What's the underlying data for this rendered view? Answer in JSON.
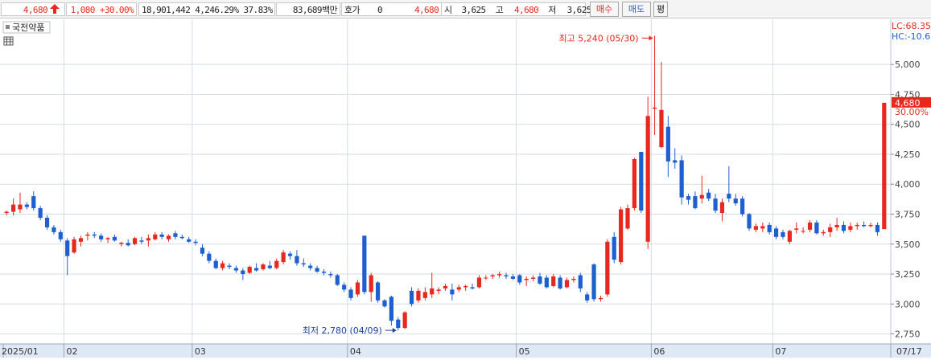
{
  "header": {
    "price": "4,680",
    "change": "1,080",
    "change_rate": "+30.00%",
    "volume": "18,901,442",
    "volume_rate": "4,246.29%",
    "turnover": "37.83%",
    "amount": "83,689백만",
    "hoga_label": "호가",
    "hoga_value": "0",
    "hoga_price": "4,680",
    "open_label": "시",
    "open": "3,625",
    "high_label": "고",
    "high": "4,680",
    "low_label": "저",
    "low": "3,625",
    "buy_label": "매수",
    "sell_label": "매도",
    "eval_label": "평"
  },
  "chart": {
    "stock_name": "국전약품",
    "lc_label": "LC:68.35",
    "hc_label": "HC:-10.6",
    "current_price_tag": "4,680",
    "current_rate_tag": "30.00%",
    "high_note": "최고 5,240 (05/30)",
    "low_note": "최저 2,780 (04/09)",
    "y_ticks": [
      "5,000",
      "4,750",
      "4,500",
      "4,250",
      "4,000",
      "3,750",
      "3,500",
      "3,250",
      "3,000",
      "2,750"
    ],
    "x_labels": [
      "2025/01",
      "02",
      "03",
      "04",
      "05",
      "06",
      "07",
      "07/17"
    ],
    "colors": {
      "up": "#e8281e",
      "down": "#1e5fd0",
      "grid": "#d5dce6",
      "axis_bg": "#dfe8f5"
    }
  },
  "chart_data": {
    "type": "candlestick",
    "ylim": [
      2680,
      5350
    ],
    "series": [
      {
        "date": "2025/01",
        "o": 3760,
        "h": 3780,
        "l": 3740,
        "c": 3770
      },
      {
        "o": 3770,
        "h": 3880,
        "l": 3740,
        "c": 3830
      },
      {
        "o": 3790,
        "h": 3930,
        "l": 3760,
        "c": 3830
      },
      {
        "o": 3830,
        "h": 3850,
        "l": 3790,
        "c": 3810
      },
      {
        "o": 3900,
        "h": 3940,
        "l": 3780,
        "c": 3800
      },
      {
        "o": 3800,
        "h": 3820,
        "l": 3700,
        "c": 3720
      },
      {
        "o": 3720,
        "h": 3740,
        "l": 3620,
        "c": 3640
      },
      {
        "o": 3640,
        "h": 3660,
        "l": 3580,
        "c": 3600
      },
      {
        "o": 3600,
        "h": 3620,
        "l": 3520,
        "c": 3540
      },
      {
        "date": "02",
        "o": 3530,
        "h": 3550,
        "l": 3240,
        "c": 3400
      },
      {
        "o": 3430,
        "h": 3560,
        "l": 3420,
        "c": 3540
      },
      {
        "o": 3520,
        "h": 3570,
        "l": 3480,
        "c": 3550
      },
      {
        "o": 3570,
        "h": 3600,
        "l": 3530,
        "c": 3580
      },
      {
        "o": 3580,
        "h": 3600,
        "l": 3550,
        "c": 3570
      },
      {
        "o": 3570,
        "h": 3590,
        "l": 3520,
        "c": 3540
      },
      {
        "o": 3540,
        "h": 3560,
        "l": 3510,
        "c": 3550
      },
      {
        "o": 3560,
        "h": 3580,
        "l": 3520,
        "c": 3530
      },
      {
        "o": 3500,
        "h": 3520,
        "l": 3480,
        "c": 3510
      },
      {
        "o": 3510,
        "h": 3540,
        "l": 3480,
        "c": 3490
      },
      {
        "o": 3500,
        "h": 3560,
        "l": 3490,
        "c": 3550
      },
      {
        "o": 3530,
        "h": 3560,
        "l": 3500,
        "c": 3520
      },
      {
        "o": 3530,
        "h": 3580,
        "l": 3480,
        "c": 3550
      },
      {
        "o": 3540,
        "h": 3600,
        "l": 3530,
        "c": 3580
      },
      {
        "o": 3580,
        "h": 3600,
        "l": 3540,
        "c": 3560
      },
      {
        "o": 3540,
        "h": 3580,
        "l": 3520,
        "c": 3570
      },
      {
        "o": 3590,
        "h": 3610,
        "l": 3540,
        "c": 3560
      },
      {
        "o": 3560,
        "h": 3580,
        "l": 3540,
        "c": 3550
      },
      {
        "o": 3540,
        "h": 3560,
        "l": 3510,
        "c": 3520
      },
      {
        "date": "03",
        "o": 3520,
        "h": 3540,
        "l": 3490,
        "c": 3510
      },
      {
        "o": 3470,
        "h": 3500,
        "l": 3400,
        "c": 3420
      },
      {
        "o": 3420,
        "h": 3440,
        "l": 3340,
        "c": 3360
      },
      {
        "o": 3360,
        "h": 3380,
        "l": 3290,
        "c": 3300
      },
      {
        "o": 3300,
        "h": 3360,
        "l": 3280,
        "c": 3340
      },
      {
        "o": 3320,
        "h": 3340,
        "l": 3290,
        "c": 3310
      },
      {
        "o": 3300,
        "h": 3320,
        "l": 3260,
        "c": 3280
      },
      {
        "o": 3280,
        "h": 3300,
        "l": 3200,
        "c": 3250
      },
      {
        "o": 3260,
        "h": 3320,
        "l": 3250,
        "c": 3310
      },
      {
        "o": 3300,
        "h": 3340,
        "l": 3270,
        "c": 3280
      },
      {
        "o": 3290,
        "h": 3340,
        "l": 3280,
        "c": 3330
      },
      {
        "o": 3320,
        "h": 3360,
        "l": 3290,
        "c": 3300
      },
      {
        "o": 3300,
        "h": 3380,
        "l": 3290,
        "c": 3360
      },
      {
        "o": 3350,
        "h": 3450,
        "l": 3330,
        "c": 3430
      },
      {
        "o": 3420,
        "h": 3440,
        "l": 3370,
        "c": 3400
      },
      {
        "o": 3400,
        "h": 3450,
        "l": 3320,
        "c": 3340
      },
      {
        "o": 3340,
        "h": 3380,
        "l": 3310,
        "c": 3330
      },
      {
        "o": 3320,
        "h": 3340,
        "l": 3280,
        "c": 3300
      },
      {
        "o": 3300,
        "h": 3320,
        "l": 3260,
        "c": 3270
      },
      {
        "o": 3270,
        "h": 3290,
        "l": 3240,
        "c": 3260
      },
      {
        "o": 3250,
        "h": 3270,
        "l": 3220,
        "c": 3240
      },
      {
        "o": 3240,
        "h": 3250,
        "l": 3150,
        "c": 3160
      },
      {
        "o": 3160,
        "h": 3180,
        "l": 3100,
        "c": 3120
      },
      {
        "date": "04",
        "o": 3120,
        "h": 3140,
        "l": 3030,
        "c": 3050
      },
      {
        "o": 3080,
        "h": 3200,
        "l": 3060,
        "c": 3180
      },
      {
        "o": 3570,
        "h": 3570,
        "l": 3080,
        "c": 3100
      },
      {
        "o": 3100,
        "h": 3260,
        "l": 3020,
        "c": 3240
      },
      {
        "o": 3180,
        "h": 3190,
        "l": 3010,
        "c": 3030
      },
      {
        "o": 3030,
        "h": 3040,
        "l": 2970,
        "c": 2980
      },
      {
        "o": 3060,
        "h": 3070,
        "l": 2820,
        "c": 2860
      },
      {
        "o": 2870,
        "h": 2890,
        "l": 2780,
        "c": 2800
      },
      {
        "o": 2800,
        "h": 2940,
        "l": 2790,
        "c": 2930
      },
      {
        "o": 3110,
        "h": 3140,
        "l": 2980,
        "c": 3000
      },
      {
        "o": 3030,
        "h": 3130,
        "l": 3010,
        "c": 3110
      },
      {
        "o": 3050,
        "h": 3140,
        "l": 3030,
        "c": 3100
      },
      {
        "o": 3080,
        "h": 3260,
        "l": 3050,
        "c": 3130
      },
      {
        "o": 3110,
        "h": 3140,
        "l": 3080,
        "c": 3120
      },
      {
        "o": 3130,
        "h": 3170,
        "l": 3110,
        "c": 3150
      },
      {
        "o": 3120,
        "h": 3170,
        "l": 3030,
        "c": 3080
      },
      {
        "o": 3120,
        "h": 3160,
        "l": 3100,
        "c": 3140
      },
      {
        "o": 3140,
        "h": 3160,
        "l": 3110,
        "c": 3150
      },
      {
        "o": 3140,
        "h": 3170,
        "l": 3120,
        "c": 3130
      },
      {
        "o": 3140,
        "h": 3240,
        "l": 3130,
        "c": 3220
      },
      {
        "o": 3220,
        "h": 3240,
        "l": 3200,
        "c": 3220
      },
      {
        "o": 3230,
        "h": 3250,
        "l": 3210,
        "c": 3240
      },
      {
        "o": 3240,
        "h": 3270,
        "l": 3220,
        "c": 3250
      },
      {
        "o": 3240,
        "h": 3260,
        "l": 3210,
        "c": 3230
      },
      {
        "o": 3230,
        "h": 3250,
        "l": 3200,
        "c": 3210
      },
      {
        "date": "05",
        "o": 3240,
        "h": 3250,
        "l": 3160,
        "c": 3180
      },
      {
        "o": 3200,
        "h": 3230,
        "l": 3150,
        "c": 3210
      },
      {
        "o": 3210,
        "h": 3240,
        "l": 3190,
        "c": 3220
      },
      {
        "o": 3230,
        "h": 3260,
        "l": 3160,
        "c": 3170
      },
      {
        "o": 3220,
        "h": 3240,
        "l": 3130,
        "c": 3140
      },
      {
        "o": 3150,
        "h": 3250,
        "l": 3140,
        "c": 3230
      },
      {
        "o": 3220,
        "h": 3240,
        "l": 3120,
        "c": 3130
      },
      {
        "o": 3140,
        "h": 3220,
        "l": 3130,
        "c": 3200
      },
      {
        "o": 3200,
        "h": 3230,
        "l": 3180,
        "c": 3210
      },
      {
        "o": 3240,
        "h": 3260,
        "l": 3100,
        "c": 3130
      },
      {
        "o": 3080,
        "h": 3100,
        "l": 3010,
        "c": 3030
      },
      {
        "o": 3330,
        "h": 3340,
        "l": 3020,
        "c": 3040
      },
      {
        "o": 3040,
        "h": 3070,
        "l": 3020,
        "c": 3050
      },
      {
        "o": 3080,
        "h": 3540,
        "l": 3060,
        "c": 3520
      },
      {
        "o": 3560,
        "h": 3600,
        "l": 3340,
        "c": 3370
      },
      {
        "o": 3350,
        "h": 3810,
        "l": 3330,
        "c": 3790
      },
      {
        "o": 3630,
        "h": 3830,
        "l": 3620,
        "c": 3800
      },
      {
        "o": 3800,
        "h": 4220,
        "l": 3780,
        "c": 4210
      },
      {
        "o": 4270,
        "h": 4270,
        "l": 3760,
        "c": 3780
      },
      {
        "o": 3520,
        "h": 4730,
        "l": 3460,
        "c": 4570
      },
      {
        "date": "06",
        "o": 4630,
        "h": 5240,
        "l": 4410,
        "c": 4640
      },
      {
        "o": 4310,
        "h": 5020,
        "l": 4300,
        "c": 4620
      },
      {
        "o": 4480,
        "h": 4570,
        "l": 4060,
        "c": 4190
      },
      {
        "o": 4200,
        "h": 4300,
        "l": 4130,
        "c": 4180
      },
      {
        "o": 4200,
        "h": 4240,
        "l": 3830,
        "c": 3890
      },
      {
        "o": 3900,
        "h": 3920,
        "l": 3830,
        "c": 3870
      },
      {
        "o": 3900,
        "h": 3940,
        "l": 3790,
        "c": 3800
      },
      {
        "o": 3880,
        "h": 4070,
        "l": 3840,
        "c": 3910
      },
      {
        "o": 3930,
        "h": 3960,
        "l": 3860,
        "c": 3880
      },
      {
        "o": 3880,
        "h": 3920,
        "l": 3760,
        "c": 3780
      },
      {
        "o": 3760,
        "h": 3880,
        "l": 3690,
        "c": 3850
      },
      {
        "o": 3920,
        "h": 4150,
        "l": 3850,
        "c": 3880
      },
      {
        "o": 3880,
        "h": 3920,
        "l": 3820,
        "c": 3840
      },
      {
        "o": 3880,
        "h": 3900,
        "l": 3730,
        "c": 3750
      },
      {
        "o": 3750,
        "h": 3760,
        "l": 3610,
        "c": 3630
      },
      {
        "o": 3620,
        "h": 3670,
        "l": 3600,
        "c": 3650
      },
      {
        "o": 3630,
        "h": 3680,
        "l": 3600,
        "c": 3650
      },
      {
        "o": 3660,
        "h": 3680,
        "l": 3580,
        "c": 3600
      },
      {
        "date": "07",
        "o": 3630,
        "h": 3650,
        "l": 3540,
        "c": 3560
      },
      {
        "o": 3600,
        "h": 3620,
        "l": 3540,
        "c": 3560
      },
      {
        "o": 3520,
        "h": 3620,
        "l": 3500,
        "c": 3610
      },
      {
        "o": 3620,
        "h": 3680,
        "l": 3590,
        "c": 3630
      },
      {
        "o": 3610,
        "h": 3640,
        "l": 3590,
        "c": 3610
      },
      {
        "o": 3620,
        "h": 3700,
        "l": 3600,
        "c": 3680
      },
      {
        "o": 3680,
        "h": 3700,
        "l": 3580,
        "c": 3590
      },
      {
        "o": 3590,
        "h": 3620,
        "l": 3570,
        "c": 3600
      },
      {
        "o": 3600,
        "h": 3670,
        "l": 3560,
        "c": 3640
      },
      {
        "o": 3640,
        "h": 3720,
        "l": 3610,
        "c": 3660
      },
      {
        "o": 3660,
        "h": 3690,
        "l": 3590,
        "c": 3610
      },
      {
        "o": 3620,
        "h": 3680,
        "l": 3600,
        "c": 3650
      },
      {
        "o": 3650,
        "h": 3680,
        "l": 3620,
        "c": 3660
      },
      {
        "o": 3660,
        "h": 3690,
        "l": 3640,
        "c": 3650
      },
      {
        "o": 3650,
        "h": 3680,
        "l": 3640,
        "c": 3660
      },
      {
        "o": 3660,
        "h": 3680,
        "l": 3570,
        "c": 3600
      },
      {
        "date": "07/17",
        "o": 3625,
        "h": 4680,
        "l": 3625,
        "c": 4680
      }
    ]
  }
}
